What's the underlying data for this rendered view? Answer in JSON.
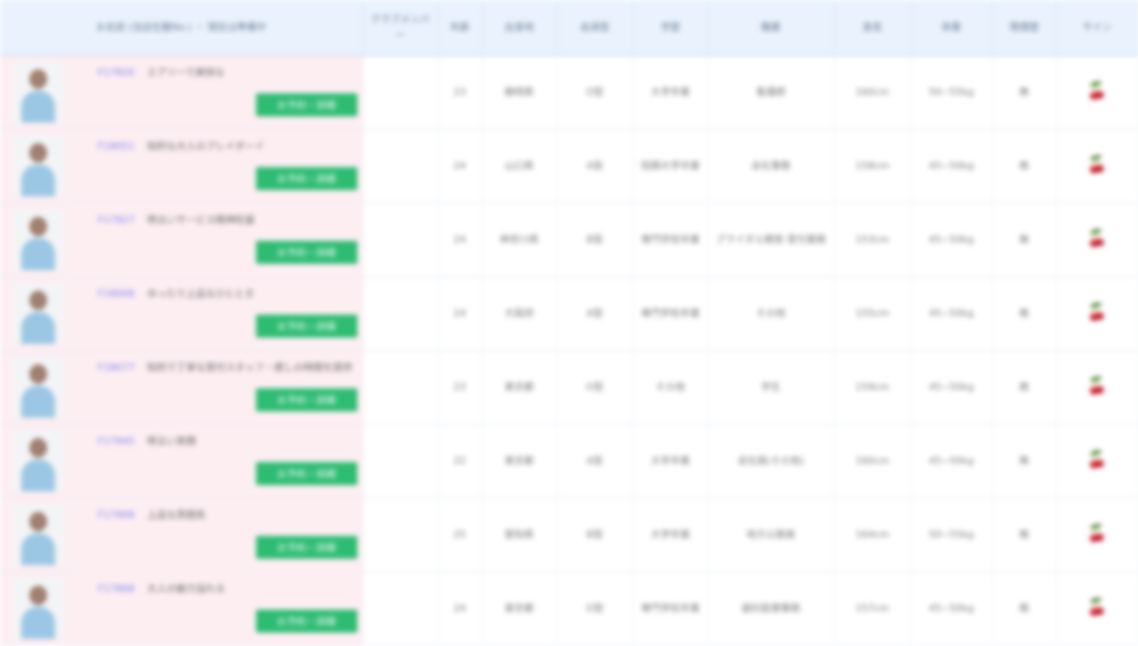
{
  "headers": {
    "name_col": "お名前 (当店在籍No.) ・ 現在は準備中",
    "club_member": "クラブメンバー",
    "age": "年齢",
    "birthplace": "出身地",
    "blood": "血液型",
    "education": "学歴",
    "job": "職業",
    "height": "身長",
    "weight": "体重",
    "smoking": "喫煙歴",
    "sign": "サイン"
  },
  "reserve_label": "お予約・詳細",
  "rows": [
    {
      "number": "F17820",
      "catch": "エアリーで爽快な",
      "club": "",
      "age": "23",
      "birthplace": "静岡県",
      "blood": "O型",
      "education": "大学卒業",
      "job": "看護師",
      "height": "160cm",
      "weight": "50~55kg",
      "smoking": "無",
      "sign_icon": "cherry-icon"
    },
    {
      "number": "F18051",
      "catch": "知的な大人のプレイボーイ",
      "club": "",
      "age": "24",
      "birthplace": "山口県",
      "blood": "A型",
      "education": "短期大学卒業",
      "job": "会社事務",
      "height": "158cm",
      "weight": "45~50kg",
      "smoking": "無",
      "sign_icon": "cherry-icon"
    },
    {
      "number": "F17827",
      "catch": "明るいサービス精神旺盛",
      "club": "",
      "age": "24",
      "birthplace": "神奈川県",
      "blood": "B型",
      "education": "専門学校卒業",
      "job": "ブライダル関係 受付業務",
      "height": "153cm",
      "weight": "45~50kg",
      "smoking": "無",
      "sign_icon": "cherry-icon"
    },
    {
      "number": "F18008",
      "catch": "ゆったり上品なひととき",
      "club": "",
      "age": "24",
      "birthplace": "大阪府",
      "blood": "A型",
      "education": "専門学校卒業",
      "job": "その他",
      "height": "155cm",
      "weight": "45~50kg",
      "smoking": "無",
      "sign_icon": "cherry-icon"
    },
    {
      "number": "F18077",
      "catch": "知的で丁寧な受付スタッフ・癒しの時間を提供",
      "club": "",
      "age": "23",
      "birthplace": "東京都",
      "blood": "O型",
      "education": "その他",
      "job": "学生",
      "height": "159cm",
      "weight": "45~50kg",
      "smoking": "無",
      "sign_icon": "cherry-icon"
    },
    {
      "number": "F17945",
      "catch": "明るい笑顔",
      "club": "",
      "age": "22",
      "birthplace": "東京都",
      "blood": "A型",
      "education": "大学卒業",
      "job": "会社員(その他)",
      "height": "160cm",
      "weight": "45~50kg",
      "smoking": "無",
      "sign_icon": "cherry-icon"
    },
    {
      "number": "F17908",
      "catch": "上品な雰囲気",
      "club": "",
      "age": "25",
      "birthplace": "愛知県",
      "blood": "B型",
      "education": "大学卒業",
      "job": "地方公務員",
      "height": "164cm",
      "weight": "50~55kg",
      "smoking": "無",
      "sign_icon": "cherry-icon"
    },
    {
      "number": "F17868",
      "catch": "大人の魅力溢れる",
      "club": "",
      "age": "24",
      "birthplace": "東京都",
      "blood": "O型",
      "education": "専門学校卒業",
      "job": "歯科医療事務",
      "height": "157cm",
      "weight": "45~50kg",
      "smoking": "無",
      "sign_icon": "cherry-icon"
    }
  ],
  "colors": {
    "header_bg": "#e9f2fd",
    "name_cell_bg": "#fdeef2",
    "reserve_button": "#2ebc72",
    "number_link": "#7f7cf0",
    "sign_icon": "#d9454f"
  }
}
